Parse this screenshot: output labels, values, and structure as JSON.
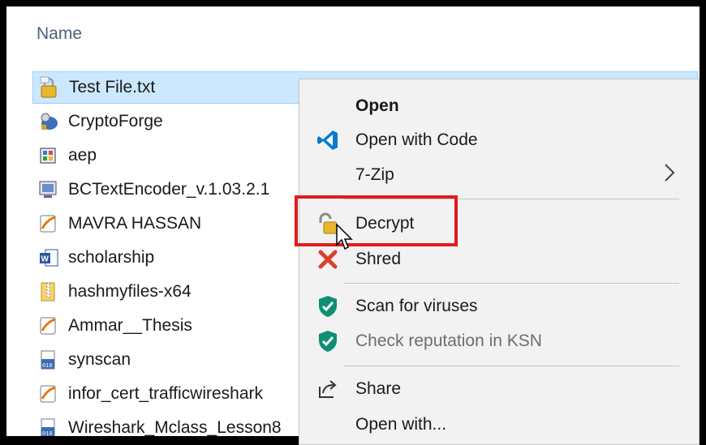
{
  "header": {
    "column_name": "Name"
  },
  "files": [
    {
      "name": "Test File.txt",
      "icon": "lock-file-icon"
    },
    {
      "name": "CryptoForge",
      "icon": "cryptoforge-icon"
    },
    {
      "name": "aep",
      "icon": "app-installer-icon"
    },
    {
      "name": "BCTextEncoder_v.1.03.2.1",
      "icon": "exe-app-icon"
    },
    {
      "name": "MAVRA HASSAN",
      "icon": "pdf-document-icon"
    },
    {
      "name": "scholarship",
      "icon": "word-document-icon"
    },
    {
      "name": "hashmyfiles-x64",
      "icon": "zip-folder-icon"
    },
    {
      "name": "Ammar__Thesis",
      "icon": "pdf-document-icon"
    },
    {
      "name": "synscan",
      "icon": "binary-file-icon"
    },
    {
      "name": "infor_cert_trafficwireshark",
      "icon": "pdf-document-icon"
    },
    {
      "name": "Wireshark_Mclass_Lesson8",
      "icon": "binary-file-icon"
    }
  ],
  "context_menu": {
    "items": [
      {
        "label": "Open",
        "icon": "",
        "bold": true
      },
      {
        "label": "Open with Code",
        "icon": "vscode-icon"
      },
      {
        "label": "7-Zip",
        "icon": "",
        "submenu": true
      },
      {
        "label": "Decrypt",
        "icon": "unlock-icon"
      },
      {
        "label": "Shred",
        "icon": "shred-x-icon"
      },
      {
        "label": "Scan for viruses",
        "icon": "kaspersky-shield-icon"
      },
      {
        "label": "Check reputation in KSN",
        "icon": "kaspersky-shield-icon",
        "disabled": true
      },
      {
        "label": "Share",
        "icon": "share-icon"
      },
      {
        "label": "Open with...",
        "icon": ""
      }
    ]
  },
  "colors": {
    "selection_bg": "#cce8ff",
    "menu_bg": "#f2f2f2",
    "highlight_border": "#e41b1b",
    "vscode_blue": "#0a7acc",
    "kaspersky_green": "#0f8f73"
  }
}
